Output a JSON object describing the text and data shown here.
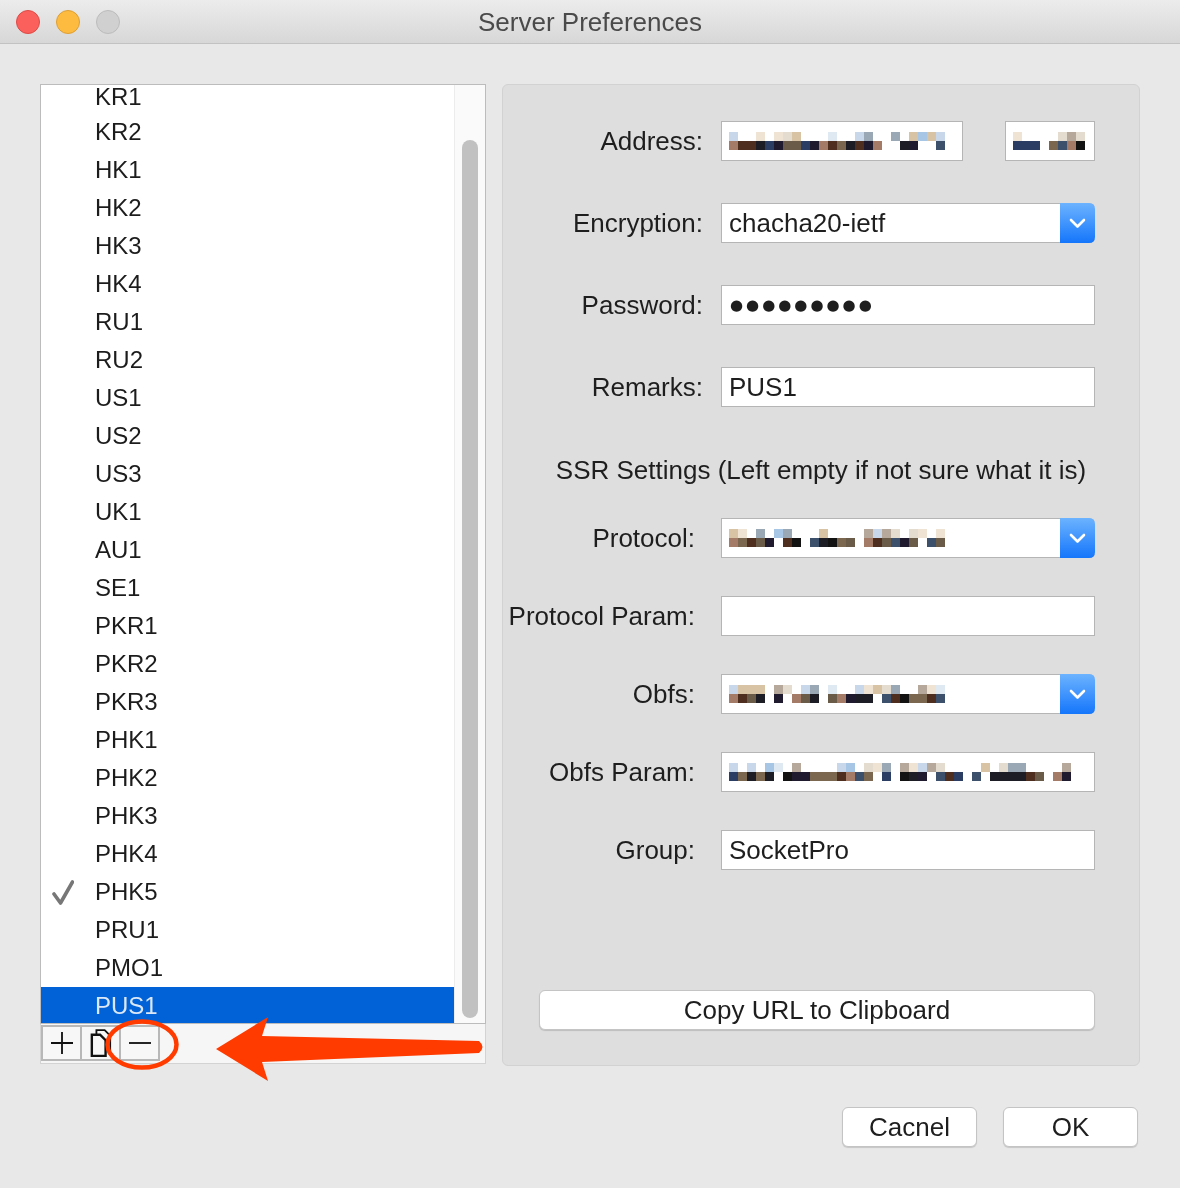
{
  "window": {
    "title": "Server Preferences",
    "controls": [
      {
        "kind": "close",
        "disabled": false
      },
      {
        "kind": "minimize",
        "disabled": false
      },
      {
        "kind": "zoom",
        "disabled": true
      }
    ]
  },
  "servers": {
    "items": [
      {
        "name": "KR1",
        "checked": false,
        "selected": false
      },
      {
        "name": "KR2",
        "checked": false,
        "selected": false
      },
      {
        "name": "HK1",
        "checked": false,
        "selected": false
      },
      {
        "name": "HK2",
        "checked": false,
        "selected": false
      },
      {
        "name": "HK3",
        "checked": false,
        "selected": false
      },
      {
        "name": "HK4",
        "checked": false,
        "selected": false
      },
      {
        "name": "RU1",
        "checked": false,
        "selected": false
      },
      {
        "name": "RU2",
        "checked": false,
        "selected": false
      },
      {
        "name": "US1",
        "checked": false,
        "selected": false
      },
      {
        "name": "US2",
        "checked": false,
        "selected": false
      },
      {
        "name": "US3",
        "checked": false,
        "selected": false
      },
      {
        "name": "UK1",
        "checked": false,
        "selected": false
      },
      {
        "name": "AU1",
        "checked": false,
        "selected": false
      },
      {
        "name": "SE1",
        "checked": false,
        "selected": false
      },
      {
        "name": "PKR1",
        "checked": false,
        "selected": false
      },
      {
        "name": "PKR2",
        "checked": false,
        "selected": false
      },
      {
        "name": "PKR3",
        "checked": false,
        "selected": false
      },
      {
        "name": "PHK1",
        "checked": false,
        "selected": false
      },
      {
        "name": "PHK2",
        "checked": false,
        "selected": false
      },
      {
        "name": "PHK3",
        "checked": false,
        "selected": false
      },
      {
        "name": "PHK4",
        "checked": false,
        "selected": false
      },
      {
        "name": "PHK5",
        "checked": true,
        "selected": false
      },
      {
        "name": "PRU1",
        "checked": false,
        "selected": false
      },
      {
        "name": "PMO1",
        "checked": false,
        "selected": false
      },
      {
        "name": "PUS1",
        "checked": false,
        "selected": true
      }
    ],
    "toolbar": [
      {
        "kind": "add"
      },
      {
        "kind": "duplicate"
      },
      {
        "kind": "remove"
      }
    ]
  },
  "settings": {
    "fields": [
      {
        "kind": "host_port",
        "label": "Address:",
        "host": {
          "redacted": true
        },
        "port": {
          "redacted": true
        }
      },
      {
        "kind": "select",
        "label": "Encryption:",
        "value": "chacha20-ietf"
      },
      {
        "kind": "password",
        "label": "Password:",
        "value": "●●●●●●●●●"
      },
      {
        "kind": "text",
        "label": "Remarks:",
        "value": "PUS1"
      }
    ],
    "ssr_heading": "SSR Settings (Left empty if not sure what it is)",
    "ssr_fields": [
      {
        "kind": "select",
        "label": "Protocol:",
        "redacted": true
      },
      {
        "kind": "text",
        "label": "Protocol Param:"
      },
      {
        "kind": "select",
        "label": "Obfs:",
        "redacted": true
      },
      {
        "kind": "text",
        "label": "Obfs Param:",
        "redacted": true
      },
      {
        "kind": "text",
        "label": "Group:",
        "value": "SocketPro"
      }
    ],
    "copy_button": "Copy URL to Clipboard"
  },
  "buttons": [
    {
      "label": "Cacnel"
    },
    {
      "label": "OK"
    }
  ],
  "annotations": [
    {
      "kind": "ellipse",
      "color": "#ff3b00"
    },
    {
      "kind": "arrow",
      "color": "#ff3b00"
    }
  ]
}
